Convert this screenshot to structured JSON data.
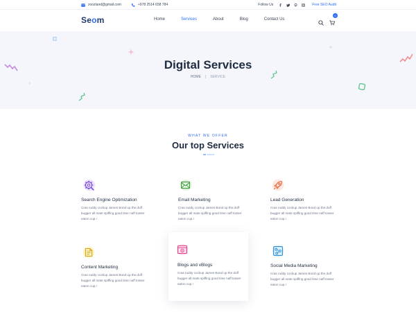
{
  "topbar": {
    "email": "zoozland@gmail.com",
    "phone": "+978 2514 658 784",
    "follow_label": "Follow Us",
    "audit_label": "Free SEO Audit",
    "social_icons": [
      "facebook-icon",
      "twitter-icon",
      "pinterest-icon",
      "instagram-icon"
    ]
  },
  "header": {
    "logo_prefix": "Se",
    "logo_o": "o",
    "logo_suffix": "m",
    "nav": [
      {
        "label": "Home"
      },
      {
        "label": "Services",
        "active": true
      },
      {
        "label": "About"
      },
      {
        "label": "Blog"
      },
      {
        "label": "Contact Us"
      }
    ],
    "cart_count": "0"
  },
  "hero": {
    "title": "Digital Services",
    "breadcrumb_home": "HOME",
    "breadcrumb_sep": "|",
    "breadcrumb_current": "SERVICE"
  },
  "section": {
    "eyebrow": "WHAT WE OFFER",
    "title": "Our top Services"
  },
  "services": [
    {
      "title": "Search Engine Optimization",
      "desc": "Cras ruddy cockup James Bond up the duff bugger all mate spiffing good time naff tosser eaton cup.!",
      "icon": "seo-gear-icon"
    },
    {
      "title": "Email Marketing",
      "desc": "Cras ruddy cockup James Bond up the duff bugger all mate spiffing good time naff tosser eaton cup.!",
      "icon": "email-icon"
    },
    {
      "title": "Lead Generation",
      "desc": "Cras ruddy cockup James Bond up the duff bugger all mate spiffing good time naff tosser eaton cup.!",
      "icon": "rocket-icon"
    },
    {
      "title": "Content Marketing",
      "desc": "Cras ruddy cockup James Bond up the duff bugger all mate spiffing good time naff tosser eaton cup.!",
      "icon": "content-icon"
    },
    {
      "title": "Blogs and vBlogs",
      "desc": "Cras ruddy cockup James Bond up the duff bugger all mate spiffing good time naff tosser eaton cup.!",
      "icon": "blog-icon"
    },
    {
      "title": "Social Media Marketing",
      "desc": "Cras ruddy cockup James Bond up the duff bugger all mate spiffing good time naff tosser eaton cup.!",
      "icon": "social-media-icon"
    }
  ],
  "colors": {
    "accent": "#2b6df6",
    "hero_bg": "#f4f6fc",
    "heading": "#1f2b40",
    "body_text": "#6b7487"
  }
}
